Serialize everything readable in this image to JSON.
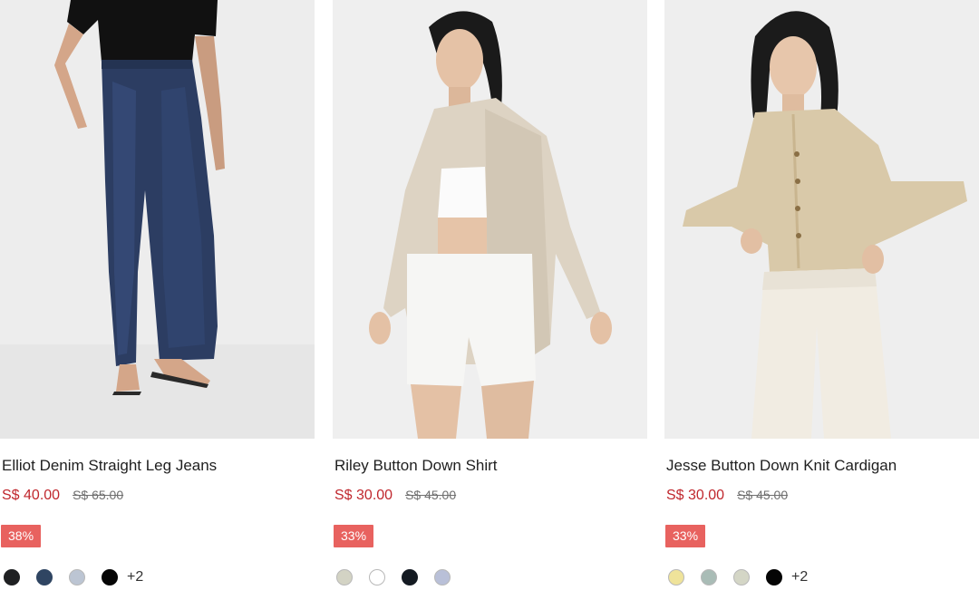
{
  "products": [
    {
      "name": "Elliot Denim Straight Leg Jeans",
      "sale_price": "S$ 40.00",
      "original_price": "S$ 65.00",
      "discount": "38%",
      "swatches": [
        "#1f2022",
        "#2f4562",
        "#bcc5d3",
        "#050505"
      ],
      "more_colors": "+2"
    },
    {
      "name": "Riley Button Down Shirt",
      "sale_price": "S$ 30.00",
      "original_price": "S$ 45.00",
      "discount": "33%",
      "swatches": [
        "#d3d3c4",
        "#ffffff",
        "#141a22",
        "#b9c0d8"
      ],
      "more_colors": ""
    },
    {
      "name": "Jesse Button Down Knit Cardigan",
      "sale_price": "S$ 30.00",
      "original_price": "S$ 45.00",
      "discount": "33%",
      "swatches": [
        "#efe39a",
        "#a9bcb6",
        "#d4d6c6",
        "#050505"
      ],
      "more_colors": "+2"
    }
  ]
}
